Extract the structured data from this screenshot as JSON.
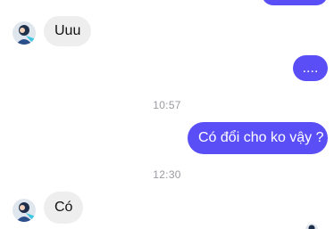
{
  "conversation": {
    "messages": [
      {
        "direction": "incoming",
        "text": "Uuu"
      },
      {
        "direction": "outgoing",
        "text": "...."
      },
      {
        "direction": "outgoing",
        "text": "Có đổi cho ko vậy ?"
      },
      {
        "direction": "incoming",
        "text": "Có"
      }
    ],
    "timestamps": [
      "10:57",
      "12:30"
    ]
  },
  "colors": {
    "outgoing_bubble": "#5a4ff7",
    "incoming_bubble": "#eeeeef",
    "timestamp": "#9a9aa0"
  },
  "icons": {
    "contact_avatar": "avatar-icon"
  }
}
